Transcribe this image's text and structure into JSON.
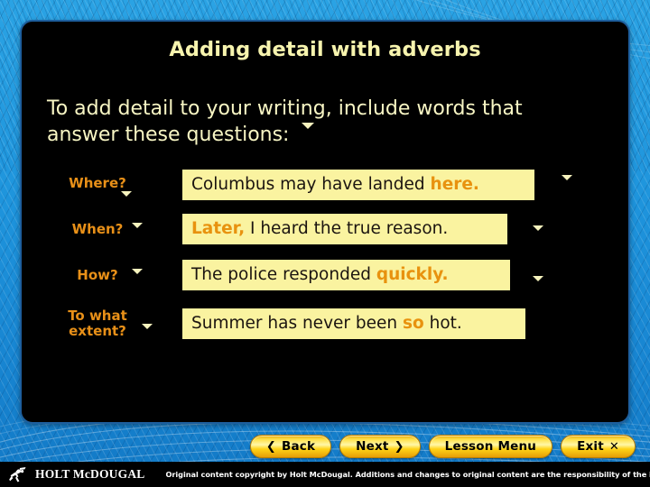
{
  "slide": {
    "title": "Adding detail with adverbs",
    "intro_line1": "To add detail to your writing, include words that",
    "intro_line2": "answer these questions:",
    "colors": {
      "background_blue": "#1E94DC",
      "panel_black": "#000000",
      "panel_border": "#1d5f9e",
      "title_yellow": "#F7F4AE",
      "body_yellow": "#F8F6C4",
      "label_orange": "#E89018",
      "sentence_bg": "#FAF3A0",
      "sentence_text": "#1b1410",
      "highlight_orange": "#E8920F",
      "button_gold": "#FFD317"
    }
  },
  "rows": [
    {
      "label": "Where?",
      "label_line2": "",
      "sentence_prefix": "Columbus may have landed ",
      "sentence_highlight": "here.",
      "sentence_suffix": "",
      "full_sentence": "Columbus may have landed here."
    },
    {
      "label": "When?",
      "label_line2": "",
      "sentence_prefix": "",
      "sentence_highlight": "Later,",
      "sentence_suffix": " I heard the true reason.",
      "full_sentence": "Later, I heard the true reason."
    },
    {
      "label": "How?",
      "label_line2": "",
      "sentence_prefix": "The police responded ",
      "sentence_highlight": "quickly.",
      "sentence_suffix": "",
      "full_sentence": "The police responded quickly."
    },
    {
      "label": "To what",
      "label_line2": "extent?",
      "sentence_prefix": "Summer has never been ",
      "sentence_highlight": "so",
      "sentence_suffix": " hot.",
      "full_sentence": "Summer has never been so hot."
    }
  ],
  "nav": {
    "back_label": "Back",
    "back_chevron": "❮",
    "next_label": "Next",
    "next_chevron": "❯",
    "lesson_menu_label": "Lesson Menu",
    "exit_label": "Exit",
    "exit_glyph": "✕"
  },
  "footer": {
    "logo_text": "HOLT McDOUGAL",
    "copyright": "Original content copyright by Holt McDougal. Additions and changes to original content are the responsibility of the instructor."
  }
}
